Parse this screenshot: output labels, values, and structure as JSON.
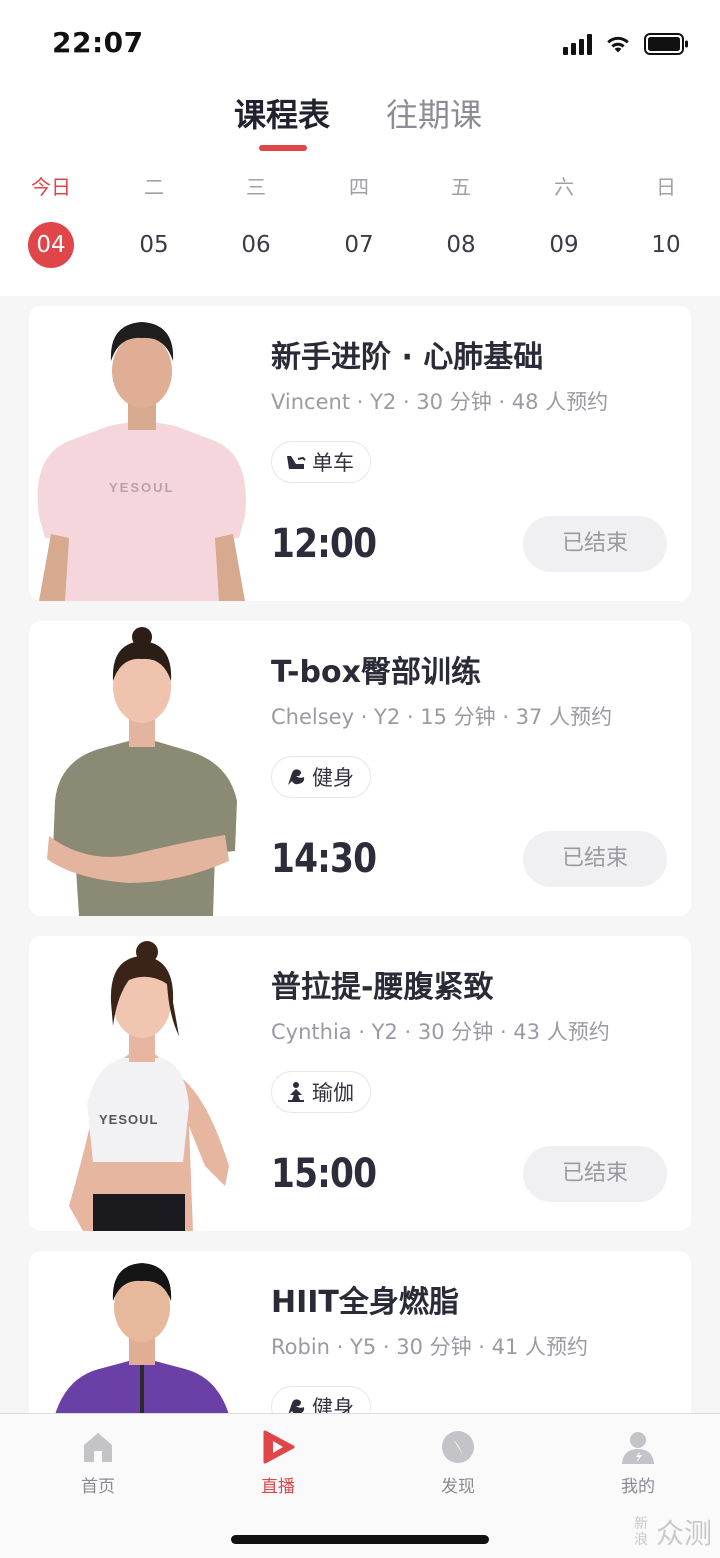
{
  "status_bar": {
    "time": "22:07"
  },
  "header": {
    "tabs": [
      {
        "label": "课程表",
        "active": true
      },
      {
        "label": "往期课",
        "active": false
      }
    ]
  },
  "week": [
    {
      "weekday": "今日",
      "date": "04",
      "selected": true
    },
    {
      "weekday": "二",
      "date": "05"
    },
    {
      "weekday": "三",
      "date": "06"
    },
    {
      "weekday": "四",
      "date": "07"
    },
    {
      "weekday": "五",
      "date": "08"
    },
    {
      "weekday": "六",
      "date": "09"
    },
    {
      "weekday": "日",
      "date": "10"
    }
  ],
  "courses": [
    {
      "title": "新手进阶 · 心肺基础",
      "meta": "Vincent · Y2 · 30 分钟 · 48 人预约",
      "tag": "单车",
      "tag_icon": "bike-icon",
      "time": "12:00",
      "status": "已结束",
      "shirt_text": "YESOUL",
      "shirt_color": "#f4d6dc"
    },
    {
      "title": "T-box臀部训练",
      "meta": "Chelsey · Y2 · 15 分钟 · 37 人预约",
      "tag": "健身",
      "tag_icon": "muscle-icon",
      "time": "14:30",
      "status": "已结束",
      "shirt_color": "#8b8a74"
    },
    {
      "title": "普拉提-腰腹紧致",
      "meta": "Cynthia · Y2 · 30 分钟 · 43 人预约",
      "tag": "瑜伽",
      "tag_icon": "yoga-icon",
      "time": "15:00",
      "status": "已结束",
      "shirt_text": "YESOUL",
      "shirt_color": "#f2f1f4"
    },
    {
      "title": "HIIT全身燃脂",
      "meta": "Robin · Y5 · 30 分钟 · 41 人预约",
      "tag": "健身",
      "tag_icon": "muscle-icon",
      "time": "",
      "status": "",
      "shirt_color": "#6a3fa6"
    }
  ],
  "tabbar": [
    {
      "label": "首页",
      "icon": "home-icon"
    },
    {
      "label": "直播",
      "icon": "live-play-icon",
      "active": true
    },
    {
      "label": "发现",
      "icon": "compass-icon"
    },
    {
      "label": "我的",
      "icon": "profile-icon"
    }
  ],
  "watermark": {
    "small": "新浪",
    "text": "众测"
  },
  "colors": {
    "accent": "#e0454a",
    "text": "#2c2c3a",
    "muted": "#9a9aa4",
    "background": "#f6f6f7"
  }
}
